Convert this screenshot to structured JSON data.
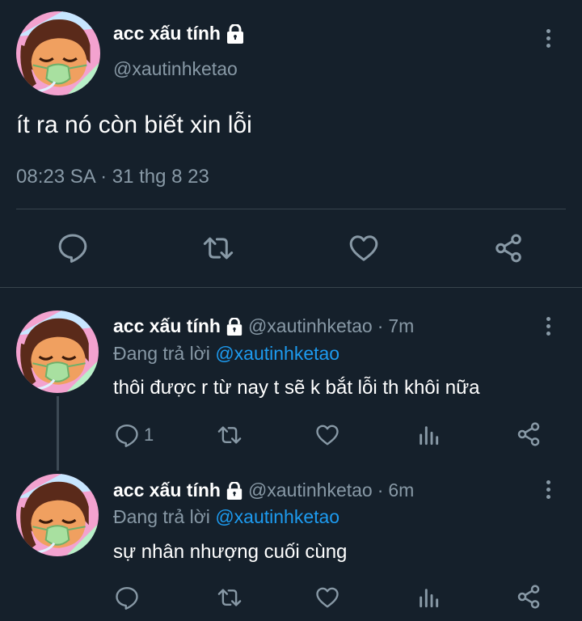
{
  "main_tweet": {
    "display_name": "acc xấu tính",
    "handle": "@xautinhketao",
    "text": "ít ra nó còn biết xin lỗi",
    "timestamp": "08:23 SA · 31 thg 8 23"
  },
  "replies": [
    {
      "display_name": "acc xấu tính",
      "handle": "@xautinhketao",
      "time": "7m",
      "replying_prefix": "Đang trả lời",
      "replying_to": "@xautinhketao",
      "text": "thôi được r từ nay t sẽ k bắt lỗi th khôi nữa",
      "reply_count": "1"
    },
    {
      "display_name": "acc xấu tính",
      "handle": "@xautinhketao",
      "time": "6m",
      "replying_prefix": "Đang trả lời",
      "replying_to": "@xautinhketao",
      "text": "sự nhân nhượng cuối cùng",
      "reply_count": ""
    }
  ],
  "separator": "·",
  "icons": [
    "lock-icon",
    "more-icon",
    "reply-icon",
    "retweet-icon",
    "like-icon",
    "share-icon",
    "views-icon"
  ],
  "colors": {
    "background": "#15202b",
    "muted": "#8899a6",
    "link": "#1d9bf0",
    "divider": "#38444d"
  }
}
